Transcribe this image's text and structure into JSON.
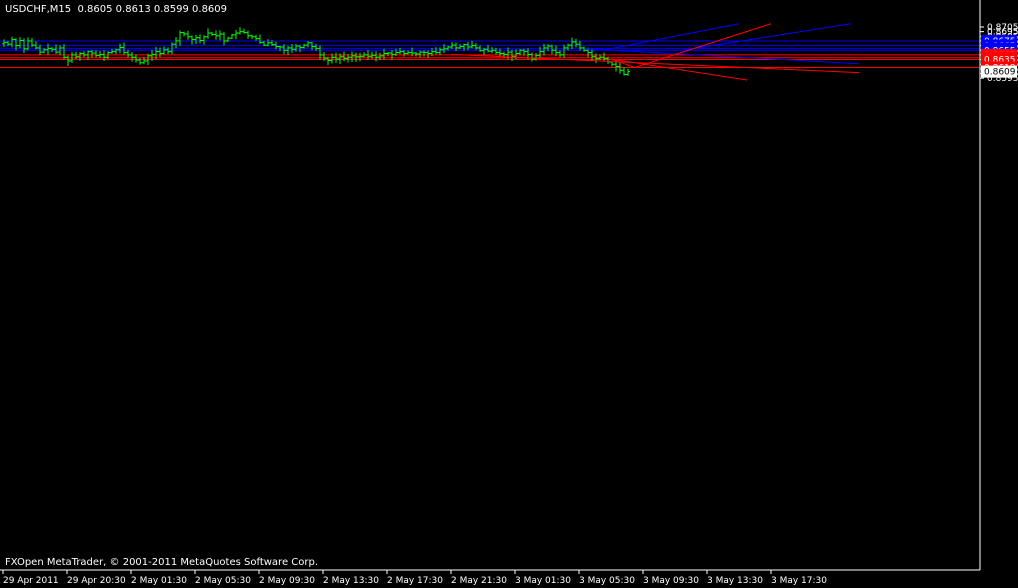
{
  "header": {
    "symbol": "USDCHF,M15",
    "ohlc": "0.8605 0.8613 0.8599 0.8609"
  },
  "footer": {
    "copyright": "FXOpen MetaTrader, © 2001-2011 MetaQuotes Software Corp."
  },
  "colors": {
    "background": "#000000",
    "axis": "#ffffff",
    "bars": "#00ff00",
    "blue_lines": "#0000ff",
    "red_lines": "#ff0000",
    "current_price_tag": "#ffffff"
  },
  "chart_data": {
    "type": "bar",
    "subtype": "ohlc",
    "symbol": "USDCHF",
    "timeframe": "M15",
    "ylim": [
      0.8593,
      0.8712
    ],
    "y_ticks": [
      "0.8705",
      "0.8695",
      "0.8685",
      "0.8675",
      "0.8665",
      "0.8655",
      "0.8645",
      "0.8635",
      "0.8625",
      "0.8615",
      "0.8605",
      "0.8595"
    ],
    "x_ticks": [
      "29 Apr 2011",
      "29 Apr 20:30",
      "2 May 01:30",
      "2 May 05:30",
      "2 May 09:30",
      "2 May 13:30",
      "2 May 17:30",
      "2 May 21:30",
      "3 May 01:30",
      "3 May 05:30",
      "3 May 09:30",
      "3 May 13:30",
      "3 May 17:30"
    ],
    "current_price": "0.8609",
    "horizontal_levels": [
      {
        "label": "0.8675",
        "color": "blue"
      },
      {
        "label": "0.8665",
        "color": "blue"
      },
      {
        "label": "0.8659",
        "color": "blue"
      },
      {
        "label": "0.8655",
        "color": "blue"
      },
      {
        "label": "0.8645",
        "color": "red"
      },
      {
        "label": "0.8639",
        "color": "red"
      },
      {
        "label": "0.8635",
        "color": "red"
      },
      {
        "label": "0.8618",
        "color": "red"
      }
    ],
    "trendlines": [
      {
        "color": "blue",
        "from": [
          "3 May 06:00",
          0.8658
        ],
        "to": [
          "3 May 23:00",
          0.8626
        ]
      },
      {
        "color": "blue",
        "from": [
          "3 May 07:00",
          0.8655
        ],
        "to": [
          "3 May 15:30",
          0.8712
        ]
      },
      {
        "color": "blue",
        "from": [
          "3 May 12:00",
          0.8655
        ],
        "to": [
          "3 May 22:30",
          0.8712
        ]
      },
      {
        "color": "red",
        "from": [
          "2 May 21:30",
          0.8646
        ],
        "to": [
          "3 May 23:00",
          0.8607
        ]
      },
      {
        "color": "red",
        "from": [
          "3 May 07:30",
          0.8636
        ],
        "to": [
          "3 May 16:00",
          0.8591
        ]
      },
      {
        "color": "red",
        "from": [
          "3 May 09:00",
          0.8618
        ],
        "to": [
          "3 May 17:30",
          0.8712
        ]
      },
      {
        "color": "red",
        "from": [
          "3 May 09:00",
          0.8618
        ],
        "to": [
          "3 May 07:30",
          0.8636
        ]
      }
    ],
    "series_close": [
      0.8672,
      0.8668,
      0.8678,
      0.8665,
      0.8676,
      0.8658,
      0.8675,
      0.8666,
      0.866,
      0.8651,
      0.8656,
      0.8659,
      0.8657,
      0.8651,
      0.866,
      0.864,
      0.8632,
      0.8645,
      0.8641,
      0.8648,
      0.8645,
      0.8652,
      0.8649,
      0.8644,
      0.8646,
      0.864,
      0.865,
      0.8652,
      0.8656,
      0.8661,
      0.865,
      0.8645,
      0.864,
      0.8634,
      0.8628,
      0.8632,
      0.8643,
      0.8646,
      0.8652,
      0.8648,
      0.8656,
      0.8652,
      0.8668,
      0.8675,
      0.8693,
      0.869,
      0.8684,
      0.8678,
      0.8682,
      0.8676,
      0.8684,
      0.8692,
      0.8689,
      0.8686,
      0.869,
      0.8675,
      0.8681,
      0.8688,
      0.8692,
      0.8695,
      0.8693,
      0.8686,
      0.8684,
      0.868,
      0.8672,
      0.8666,
      0.8671,
      0.8667,
      0.8663,
      0.8662,
      0.8655,
      0.866,
      0.8657,
      0.8664,
      0.8661,
      0.8666,
      0.8671,
      0.8663,
      0.8659,
      0.8645,
      0.8638,
      0.8633,
      0.864,
      0.8636,
      0.8642,
      0.8637,
      0.864,
      0.8643,
      0.8641,
      0.8642,
      0.8645,
      0.8642,
      0.8644,
      0.864,
      0.8643,
      0.8648,
      0.8649,
      0.8646,
      0.865,
      0.8652,
      0.8648,
      0.865,
      0.8649,
      0.8647,
      0.8651,
      0.865,
      0.8648,
      0.8652,
      0.865,
      0.8656,
      0.8658,
      0.8662,
      0.8666,
      0.866,
      0.8663,
      0.8667,
      0.8662,
      0.8665,
      0.866,
      0.8654,
      0.8657,
      0.8653,
      0.8655,
      0.865,
      0.8648,
      0.8646,
      0.8651,
      0.8642,
      0.8648,
      0.8655,
      0.8652,
      0.8646,
      0.8636,
      0.8644,
      0.8652,
      0.866,
      0.8664,
      0.8655,
      0.865,
      0.8645,
      0.866,
      0.8666,
      0.8673,
      0.8668,
      0.866,
      0.8655,
      0.865,
      0.8642,
      0.8637,
      0.864,
      0.8637,
      0.863,
      0.8625,
      0.862,
      0.8612,
      0.8603,
      0.8609
    ]
  }
}
